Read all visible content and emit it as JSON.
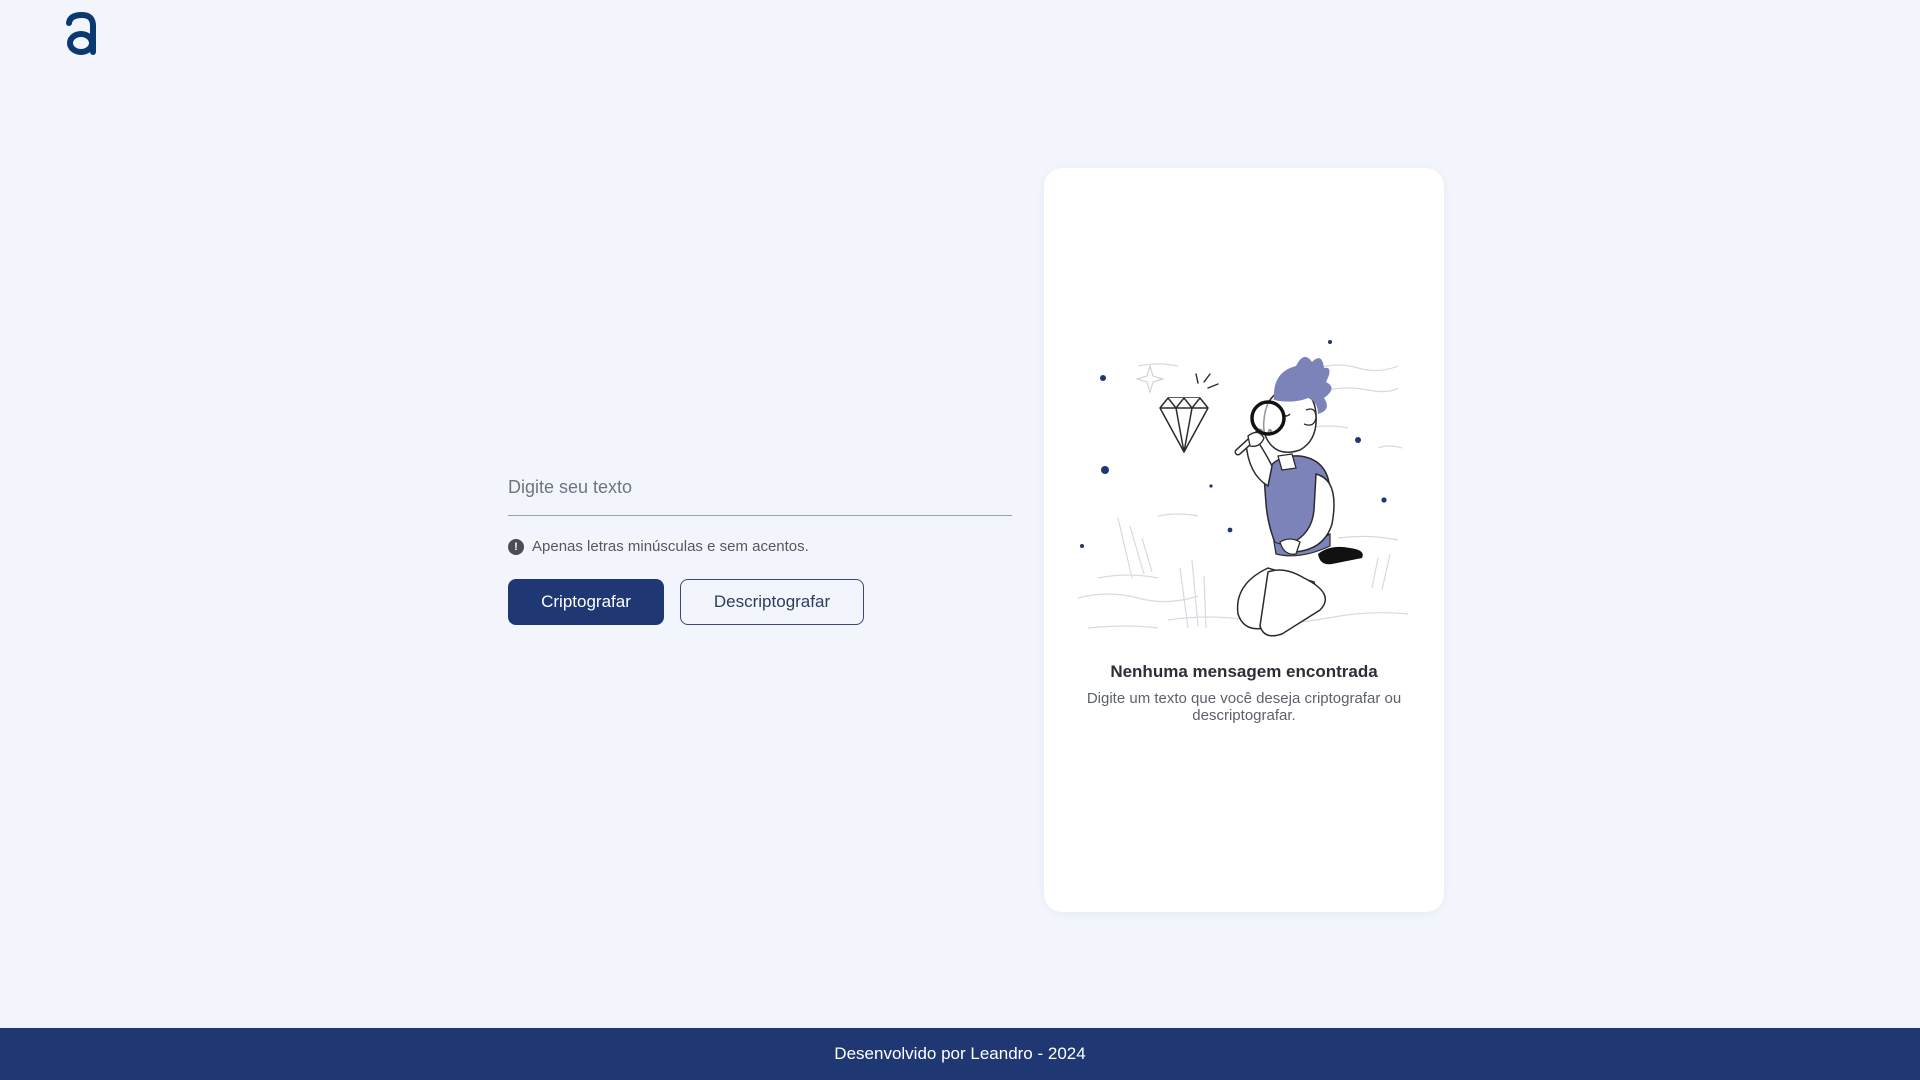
{
  "header": {
    "logo_icon": "alura-a-logo-icon",
    "logo_color": "#0a3871"
  },
  "form": {
    "input_placeholder": "Digite seu texto",
    "input_value": "",
    "hint_icon": "exclamation-circle-icon",
    "hint_text": "Apenas letras minúsculas e sem acentos.",
    "encrypt_label": "Criptografar",
    "decrypt_label": "Descriptografar"
  },
  "output_panel": {
    "illustration_icon": "person-inspecting-diamond-icon",
    "title": "Nenhuma mensagem encontrada",
    "description": "Digite um texto que você deseja criptografar ou descriptografar."
  },
  "footer": {
    "text": "Desenvolvido por Leandro - 2024"
  },
  "colors": {
    "background": "#f2f5fc",
    "primary": "#1f3873",
    "card": "#ffffff",
    "accent_illustration": "#7b83b8"
  }
}
